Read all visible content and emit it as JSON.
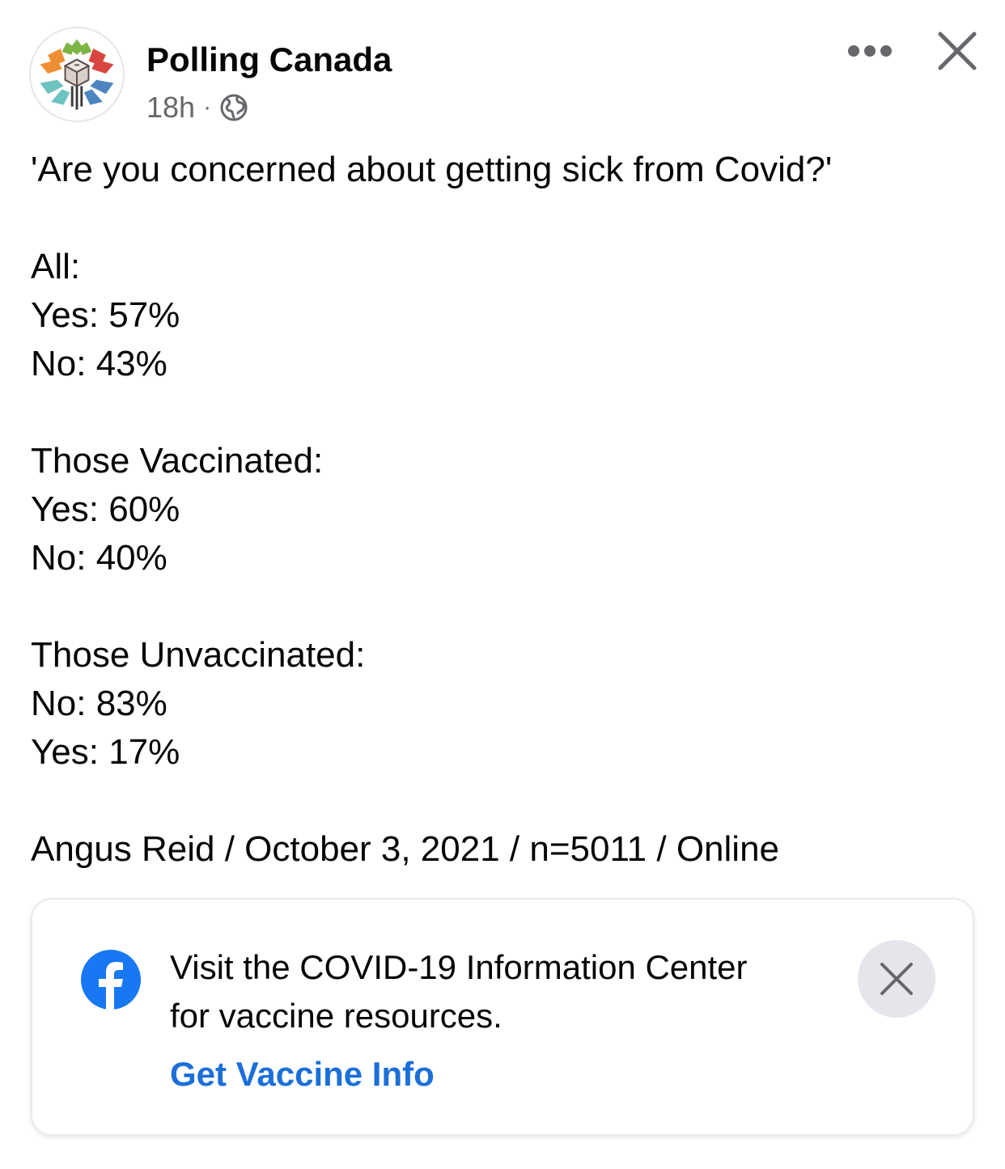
{
  "post": {
    "page_name": "Polling Canada",
    "time": "18h",
    "separator": "·",
    "privacy_icon": "globe-icon",
    "more_icon": "more-horizontal-icon",
    "close_icon": "close-icon",
    "lines": [
      "'Are you concerned about getting sick from Covid?'",
      "",
      "All:",
      "Yes: 57%",
      "No: 43%",
      "",
      "Those Vaccinated:",
      "Yes: 60%",
      "No: 40%",
      "",
      "Those Unvaccinated:",
      "No: 83%",
      "Yes: 17%",
      "",
      "Angus Reid / October 3, 2021 / n=5011 / Online"
    ]
  },
  "info_card": {
    "icon": "facebook-icon",
    "text_line1": "Visit the COVID-19 Information Center",
    "text_line2": "for vaccine resources.",
    "link_label": "Get Vaccine Info",
    "dismiss_icon": "close-icon"
  },
  "colors": {
    "text": "#050505",
    "secondary_text": "#65676b",
    "link": "#1b6fd8",
    "facebook_blue": "#1877f2",
    "dismiss_bg": "#e4e6eb"
  }
}
